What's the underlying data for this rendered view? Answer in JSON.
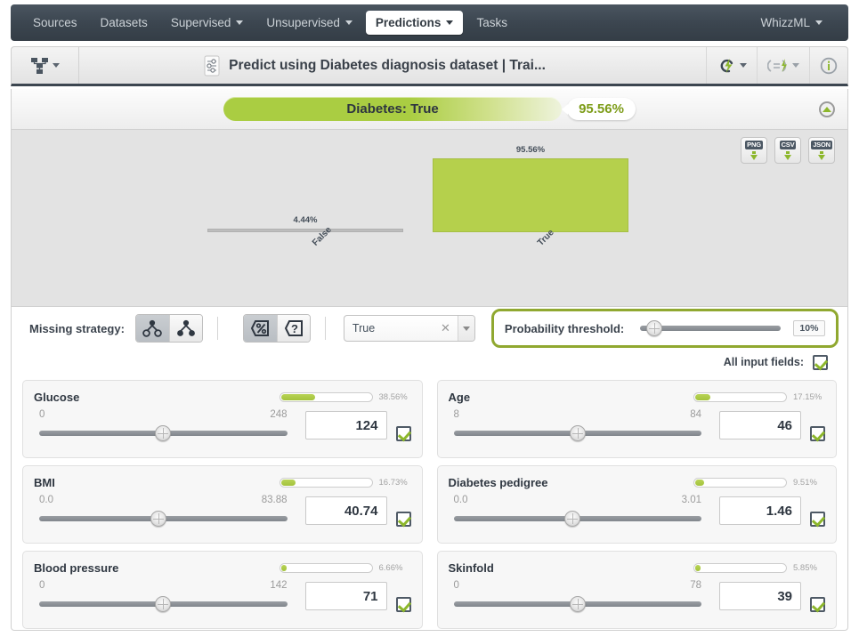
{
  "nav": {
    "items": [
      {
        "label": "Sources",
        "dropdown": false,
        "active": false
      },
      {
        "label": "Datasets",
        "dropdown": false,
        "active": false
      },
      {
        "label": "Supervised",
        "dropdown": true,
        "active": false
      },
      {
        "label": "Unsupervised",
        "dropdown": true,
        "active": false
      },
      {
        "label": "Predictions",
        "dropdown": true,
        "active": true
      },
      {
        "label": "Tasks",
        "dropdown": false,
        "active": false
      }
    ],
    "right": {
      "label": "WhizzML",
      "dropdown": true
    }
  },
  "resource_bar": {
    "title": "Predict using Diabetes diagnosis dataset | Trai...",
    "left_icon": "model-tree-icon",
    "title_icon": "sliders-icon",
    "actions": [
      {
        "icon": "lightning-cloud-icon",
        "dropdown": true
      },
      {
        "icon": "batch-prediction-icon",
        "dropdown": true
      },
      {
        "icon": "info-icon",
        "dropdown": false
      }
    ]
  },
  "prediction": {
    "pill_label": "Diabetes: True",
    "confidence": "95.56%",
    "collapse_icon": "collapse-up-icon",
    "accent_color": "#aacd42",
    "pct_text_color": "#7d9c18"
  },
  "exports": [
    {
      "label": "PNG"
    },
    {
      "label": "CSV"
    },
    {
      "label": "JSON"
    }
  ],
  "chart_data": {
    "type": "bar",
    "title": "",
    "xlabel": "",
    "ylabel": "",
    "categories": [
      "False",
      "True"
    ],
    "values": [
      4.44,
      95.56
    ],
    "value_labels": [
      "4.44%",
      "95.56%"
    ],
    "ylim": [
      0,
      100
    ],
    "grid": false,
    "legend": false,
    "bar_color": "#b5d04c",
    "low_bar_color": "#bdbdbd",
    "background": "#e3e3e3"
  },
  "controls": {
    "missing_strategy_label": "Missing strategy:",
    "missing_strategy_buttons": [
      {
        "icon": "last-prediction-icon",
        "selected": true
      },
      {
        "icon": "proportional-icon",
        "selected": false
      }
    ],
    "display_buttons": [
      {
        "icon": "percent-icon",
        "selected": true
      },
      {
        "icon": "question-icon",
        "selected": false
      }
    ],
    "class_select": {
      "value": "True",
      "clear_icon": "clear-x-icon",
      "arrow_icon": "chevron-down-icon"
    },
    "threshold": {
      "label": "Probability threshold:",
      "value": "10%",
      "percent": 10,
      "border_color": "#90a830"
    },
    "all_input_fields_label": "All input fields:",
    "all_input_fields_checked": true
  },
  "fields": [
    {
      "name": "Glucose",
      "importance_pct": "38.56%",
      "importance": 38.56,
      "min": "0",
      "max": "248",
      "value": "124",
      "slider_percent": 50,
      "checked": true
    },
    {
      "name": "Age",
      "importance_pct": "17.15%",
      "importance": 17.15,
      "min": "8",
      "max": "84",
      "value": "46",
      "slider_percent": 50,
      "checked": true
    },
    {
      "name": "BMI",
      "importance_pct": "16.73%",
      "importance": 16.73,
      "min": "0.0",
      "max": "83.88",
      "value": "40.74",
      "slider_percent": 48,
      "checked": true
    },
    {
      "name": "Diabetes pedigree",
      "importance_pct": "9.51%",
      "importance": 9.51,
      "min": "0.0",
      "max": "3.01",
      "value": "1.46",
      "slider_percent": 48,
      "checked": true
    },
    {
      "name": "Blood pressure",
      "importance_pct": "6.66%",
      "importance": 6.66,
      "min": "0",
      "max": "142",
      "value": "71",
      "slider_percent": 50,
      "checked": true
    },
    {
      "name": "Skinfold",
      "importance_pct": "5.85%",
      "importance": 5.85,
      "min": "0",
      "max": "78",
      "value": "39",
      "slider_percent": 50,
      "checked": true
    }
  ]
}
